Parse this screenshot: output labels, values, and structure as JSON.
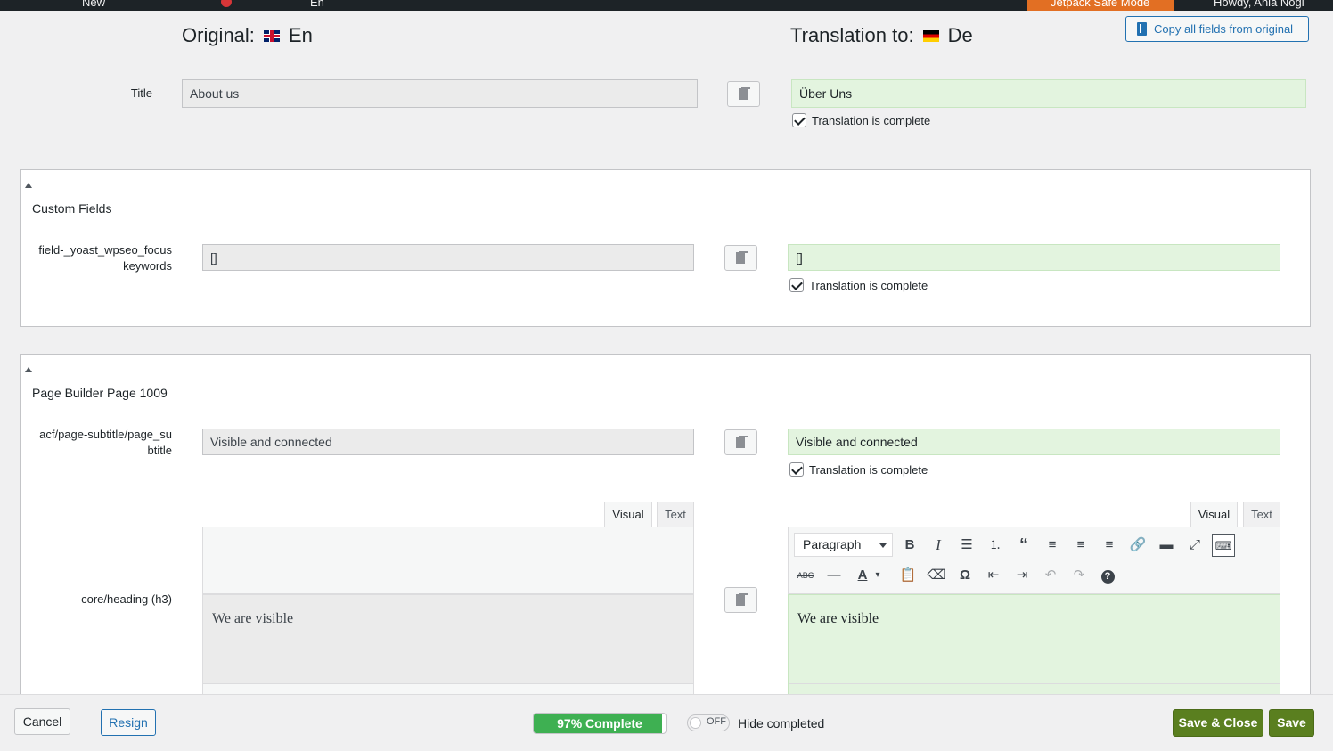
{
  "admin_bar": {
    "new_label": "New",
    "user_name": "Howdy, Ania Nogi",
    "jetpack_label": "Jetpack Safe Mode",
    "lang_label": "En"
  },
  "header": {
    "original_label": "Original:",
    "original_lang": "En",
    "translation_label": "Translation to:",
    "translation_lang": "De",
    "copy_all_label": "Copy all fields from original"
  },
  "title_row": {
    "label": "Title",
    "original": "About us",
    "translation": "Über Uns",
    "complete_label": "Translation is complete"
  },
  "custom_fields": {
    "section_title": "Custom Fields",
    "field": {
      "label": "field-_yoast_wpseo_focuskeywords",
      "original": "[]",
      "translation": "[]",
      "complete_label": "Translation is complete"
    }
  },
  "page_builder": {
    "section_title": "Page Builder Page 1009",
    "subtitle_field": {
      "label": "acf/page-subtitle/page_subtitle",
      "original": "Visible and connected",
      "translation": "Visible and connected",
      "complete_label": "Translation is complete"
    },
    "heading_field": {
      "label": "core/heading (h3)",
      "visual_tab": "Visual",
      "text_tab": "Text",
      "original": "We are visible",
      "translation": "We are visible",
      "format_select": "Paragraph"
    }
  },
  "footer": {
    "cancel_label": "Cancel",
    "resign_label": "Resign",
    "progress_label": "97% Complete",
    "progress_value": 0.97,
    "toggle_state": "OFF",
    "hide_completed_label": "Hide completed",
    "save_close_label": "Save & Close",
    "save_label": "Save"
  },
  "colors": {
    "accent": "#2271b1",
    "translation_bg": "#e3f4df",
    "progress": "#3eb052",
    "primary_button": "#5a7f1f",
    "jetpack": "#e26f23"
  },
  "icons": {
    "toolbar_row1": [
      "bold-icon",
      "italic-icon",
      "bulleted-list-icon",
      "numbered-list-icon",
      "blockquote-icon",
      "align-left-icon",
      "align-center-icon",
      "align-right-icon",
      "link-icon",
      "read-more-icon",
      "fullscreen-icon",
      "toolbar-toggle-icon"
    ],
    "toolbar_row2": [
      "strikethrough-icon",
      "horizontal-line-icon",
      "text-color-icon",
      "paste-text-icon",
      "clear-formatting-icon",
      "special-character-icon",
      "outdent-icon",
      "indent-icon",
      "undo-icon",
      "redo-icon",
      "help-icon"
    ]
  }
}
